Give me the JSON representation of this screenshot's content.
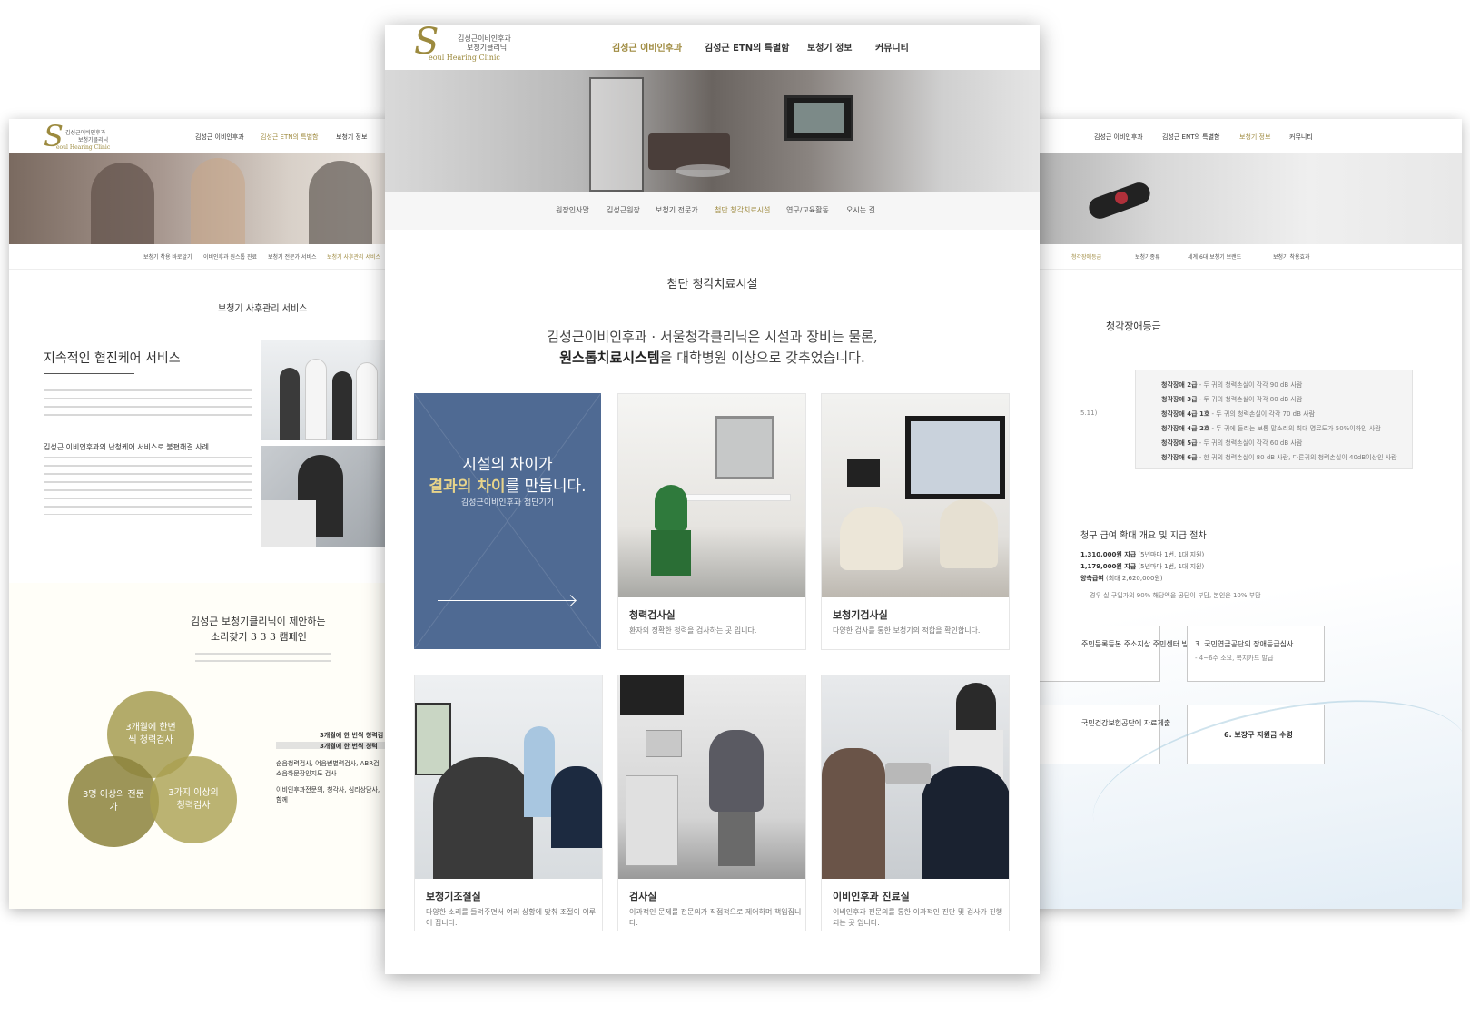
{
  "left_page": {
    "logo_line1": "김성근이비인후과",
    "logo_line2": "보청기클리닉",
    "logo_en": "eoul Hearing Clinic",
    "nav": [
      "김성근 이비인후과",
      "김성근 ETN의 특별함",
      "보청기 정보"
    ],
    "subnav": [
      "보청기 착용 바로알기",
      "이비인후과 원스톱 진료",
      "보청기 전문가 서비스",
      "보청기 사후관리 서비스"
    ],
    "section_title": "보청기 사후관리 서비스",
    "heading": "지속적인 협진케어 서비스",
    "case_heading": "김성근 이비인후과의 난청케어 서비스로 불편해결 사례",
    "campaign_line1": "김성근 보청기클리닉이 제안하는",
    "campaign_line2": "소리찾기 3 3 3 캠페인",
    "circles": [
      "3개월에 한번씩 청력검사",
      "3명 이상의 전문가",
      "3가지 이상의 청력검사"
    ],
    "bold_line": "3개월에 한 번씩 청력검",
    "bold_line2": "3개월에 한 번씩 청력",
    "line_a": "순음청력검사, 어음변별력검사, ABR검",
    "line_b": "소음하문장인지도 검사",
    "line_c": "이비인후과전문의, 청각사, 심리상담사,",
    "line_d": "함께"
  },
  "center_page": {
    "logo_line1": "김성근이비인후과",
    "logo_line2": "보청기클리닉",
    "logo_en": "eoul Hearing Clinic",
    "nav": [
      "김성근 이비인후과",
      "김성근 ETN의 특별함",
      "보청기 정보",
      "커뮤니티"
    ],
    "subnav": [
      "원장인사말",
      "김성근원장",
      "보청기 전문가",
      "첨단 청각치료시설",
      "연구/교육활동",
      "오시는 길"
    ],
    "section_title": "첨단 청각치료시설",
    "intro_line1": "김성근이비인후과 · 서울청각클리닉은 시설과 장비는 물론,",
    "intro_bold": "원스톱치료시스템",
    "intro_line2_rest": "을 대학병원 이상으로 갖추었습니다.",
    "banner_line1": "시설의 차이가",
    "banner_highlight": "결과의 차이",
    "banner_line2_rest": "를 만듭니다.",
    "banner_sub": "김성근이비인후과 첨단기기",
    "cards": [
      {
        "title": "청력검사실",
        "desc": "환자의 정확한 청력을 검사하는 곳 입니다."
      },
      {
        "title": "보청기검사실",
        "desc": "다양한 검사를 통한 보청기의 적합을 확인합니다."
      },
      {
        "title": "보청기조절실",
        "desc": "다양한 소리를 들려주면서 여러 상황에 맞춰 조절이 이루어 집니다."
      },
      {
        "title": "검사실",
        "desc": "이과적인 문제를 전문의가 직접적으로 제어하며 책임집니다."
      },
      {
        "title": "이비인후과 진료실",
        "desc": "이비인후과 전문의를 통한 이과적인 진단 및 검사가 진행되는 곳 입니다."
      }
    ]
  },
  "right_page": {
    "nav": [
      "김성근 이비인후과",
      "김성근 ENT의 특별함",
      "보청기 정보",
      "커뮤니티"
    ],
    "subnav": [
      "청각장애등급",
      "보청기종류",
      "세계 6대 보청기 브랜드",
      "보청기 착용효과"
    ],
    "section_title": "청각장애등급",
    "date_fragment": "5.11)",
    "levels": [
      {
        "grade": "청각장애 2급",
        "text": " - 두 귀의 청력손실이 각각 90 dB 사람"
      },
      {
        "grade": "청각장애 3급",
        "text": " - 두 귀의 청력손실이 각각 80 dB 사람"
      },
      {
        "grade": "청각장애 4급 1호",
        "text": " - 두 귀의 청력손실이 각각 70 dB 사람"
      },
      {
        "grade": "청각장애 4급 2호",
        "text": " - 두 귀에 들리는 보통 말소리의 최대 명료도가 50%이하인 사람"
      },
      {
        "grade": "청각장애 5급",
        "text": " - 두 귀의 청력손실이 각각 60 dB 사람"
      },
      {
        "grade": "청각장애 6급",
        "text": " - 한 귀의 청력손실이 80 dB 사람, 다른귀의 청력손실이 40dB이상인 사람"
      }
    ],
    "procedure_title": "청구 급여 확대 개요 및 지급 절차",
    "amount1": "1,310,000원 지급",
    "amount1_note": "(5년마다 1번, 1대 지원)",
    "amount2": "1,179,000원 지급",
    "amount2_note": "(5년마다 1번, 1대 지원)",
    "amount3": "양측급여",
    "amount3_note": "(최대 2,620,000원)",
    "amount_footer": "경우 실 구입가의 90% 해당액을 공단이 부담, 본인은 10% 부담",
    "step2": "주민등록등본 주소지상 주민센터 방문",
    "step3": "3. 국민연금공단의 장애등급심사",
    "step3_sub": "- 4~6주 소요, 복지카드 발급",
    "step5": "국민건강보험공단에 자료제출",
    "step6": "6. 보장구 지원금 수령"
  }
}
